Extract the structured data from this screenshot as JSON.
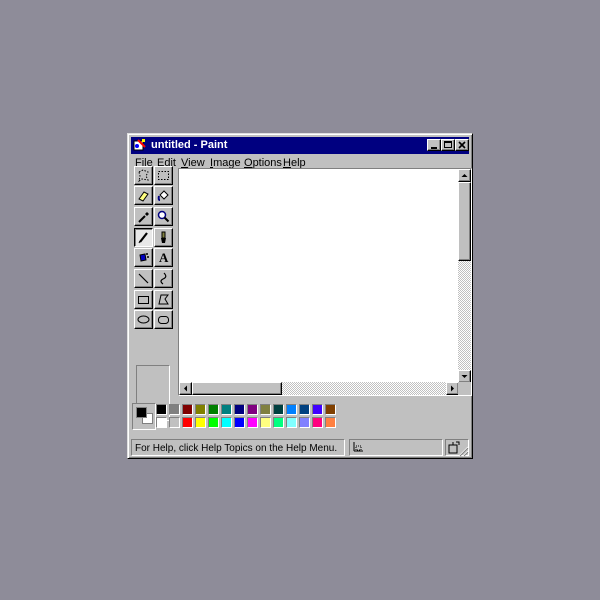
{
  "window": {
    "title": "untitled - Paint",
    "title_icon": "paint-app-icon",
    "controls": [
      "minimize-icon",
      "maximize-icon",
      "close-icon"
    ]
  },
  "menu": [
    {
      "label": "File"
    },
    {
      "label": "Edit"
    },
    {
      "label": "View"
    },
    {
      "label": "Image"
    },
    {
      "label": "Options"
    },
    {
      "label": "Help"
    }
  ],
  "tools": [
    {
      "name": "free-form-select",
      "icon": "free-form-select-icon"
    },
    {
      "name": "rect-select",
      "icon": "rect-select-icon"
    },
    {
      "name": "eraser",
      "icon": "eraser-icon"
    },
    {
      "name": "fill",
      "icon": "fill-bucket-icon"
    },
    {
      "name": "pick-color",
      "icon": "eyedropper-icon"
    },
    {
      "name": "magnifier",
      "icon": "magnifier-icon"
    },
    {
      "name": "pencil",
      "icon": "pencil-icon",
      "selected": true
    },
    {
      "name": "brush",
      "icon": "brush-icon"
    },
    {
      "name": "airbrush",
      "icon": "airbrush-icon"
    },
    {
      "name": "text",
      "icon": "text-icon",
      "glyph": "A"
    },
    {
      "name": "line",
      "icon": "line-icon"
    },
    {
      "name": "curve",
      "icon": "curve-icon"
    },
    {
      "name": "rectangle",
      "icon": "rectangle-icon"
    },
    {
      "name": "polygon",
      "icon": "polygon-icon"
    },
    {
      "name": "ellipse",
      "icon": "ellipse-icon"
    },
    {
      "name": "rounded-rectangle",
      "icon": "rounded-rectangle-icon"
    }
  ],
  "colors": {
    "foreground": "#000000",
    "background": "#ffffff",
    "palette_row1": [
      "#000000",
      "#808080",
      "#800000",
      "#808000",
      "#008000",
      "#008080",
      "#000080",
      "#800080",
      "#808040",
      "#004040",
      "#0080ff",
      "#004080",
      "#4000ff",
      "#804000"
    ],
    "palette_row2": [
      "#ffffff",
      "#c0c0c0",
      "#ff0000",
      "#ffff00",
      "#00ff00",
      "#00ffff",
      "#0000ff",
      "#ff00ff",
      "#ffff80",
      "#00ff80",
      "#80ffff",
      "#8080ff",
      "#ff0080",
      "#ff8040"
    ]
  },
  "status": {
    "help_text": "For Help, click Help Topics on the Help Menu.",
    "position_icon": "cursor-position-icon",
    "size_icon": "selection-size-icon"
  }
}
